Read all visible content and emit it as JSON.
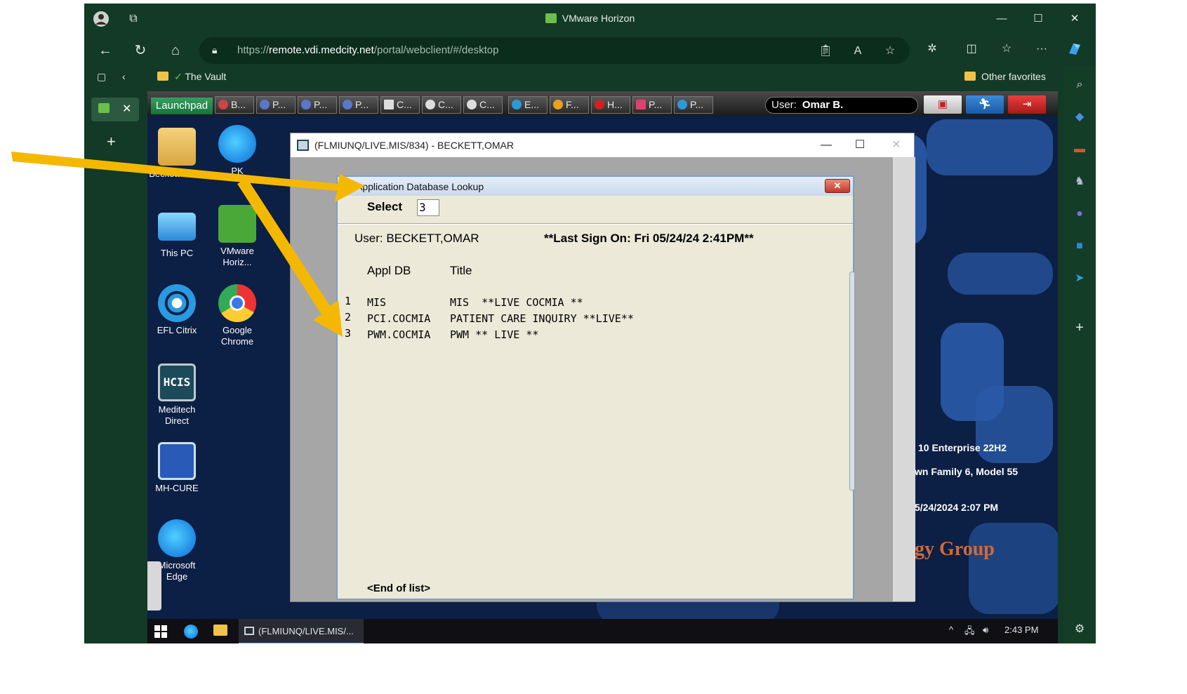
{
  "browser": {
    "window_title": "VMware Horizon",
    "url_scheme": "https://",
    "url_host": "remote.vdi.medcity.net",
    "url_path": "/portal/webclient/#/desktop",
    "favorites": [
      {
        "label": "The Vault"
      },
      {
        "label": "Other favorites"
      }
    ]
  },
  "horizon_bar": {
    "launchpad_label": "Launchpad",
    "tabs": [
      "B...",
      "P...",
      "P...",
      "P...",
      "C...",
      "C...",
      "C...",
      "E...",
      "F...",
      "H...",
      "P...",
      "P..."
    ],
    "user_label": "User:",
    "user_name": "Omar B."
  },
  "desktop_icons": [
    {
      "label": "Beckett Omar"
    },
    {
      "label": "PK"
    },
    {
      "label": "This PC"
    },
    {
      "label": "VMware Horiz..."
    },
    {
      "label": "EFL Citrix"
    },
    {
      "label": "Google Chrome"
    },
    {
      "label": "Meditech Direct"
    },
    {
      "label": "MH-CURE"
    },
    {
      "label": "Microsoft Edge"
    }
  ],
  "wallpaper_text": {
    "line1": "10 Enterprise 22H2",
    "line2": "wn Family 6, Model 55",
    "line3": "5/24/2024 2:07 PM",
    "brand": "gy Group"
  },
  "app_window": {
    "title": "(FLMIUNQ/LIVE.MIS/834) - BECKETT,OMAR"
  },
  "dialog": {
    "title": "Application Database Lookup",
    "close_label": "✕",
    "select_label": "Select",
    "select_value": "3",
    "user_line": "User: BECKETT,OMAR",
    "last_sign_on": "**Last Sign On: Fri 05/24/24 2:41PM**",
    "col_appl_db": "Appl DB",
    "col_title": "Title",
    "rows": [
      {
        "num": "1",
        "db": "MIS",
        "title": "MIS  **LIVE COCMIA **"
      },
      {
        "num": "2",
        "db": "PCI.COCMIA",
        "title": "PATIENT CARE INQUIRY **LIVE**"
      },
      {
        "num": "3",
        "db": "PWM.COCMIA",
        "title": "PWM ** LIVE **"
      }
    ],
    "end_of_list": "<End of list>"
  },
  "taskbar": {
    "app_label": "(FLMIUNQ/LIVE.MIS/...",
    "clock": "2:43 PM"
  },
  "colors": {
    "browser_frame": "#123a26",
    "desktop_bg": "#0c1f44",
    "arrow": "#f5b800",
    "dialog_bg": "#ece9d8"
  }
}
